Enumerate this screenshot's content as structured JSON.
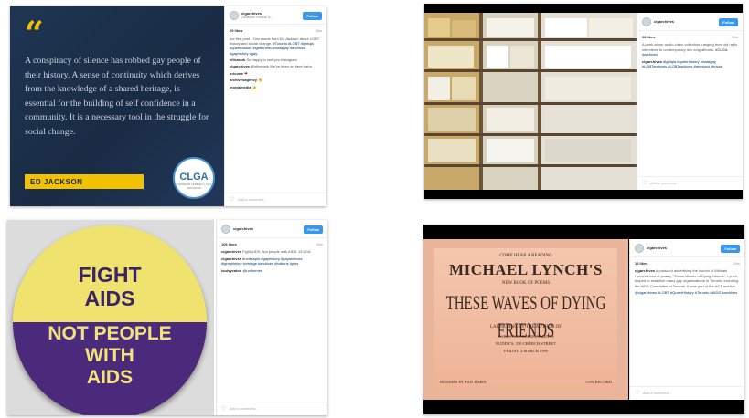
{
  "colors": {
    "follow_blue": "#3897f0",
    "quote_bg": "#1e3552",
    "quote_yellow": "#f2c200",
    "pin_yellow": "#efe26f",
    "pin_purple": "#4b2a7b",
    "poster_pink": "#f0bca1"
  },
  "post1": {
    "quote_mark": "“",
    "quote": "A conspiracy of silence has robbed gay people of their history. A sense of continuity which derives from the knowledge of a shared heritage, is essential for the building of self confidence in a community. It is a necessary tool in the struggle for social change.",
    "author": "ED JACKSON",
    "logo_text": "CLGA",
    "logo_sub": "CANADIAN LESBIAN + GAY ARCHIVES",
    "username": "clgarchives",
    "location": "Canadian Lesbian &...",
    "follow": "Follow",
    "likes": "29 likes",
    "time": "34w",
    "caption": "our first post - Two words from Ed Jackson about LGBT history and social change.",
    "tags": "#Toronto #LGBT #lgbtqia #queerhistory #lgbttoronto #instagay #archives #gayhistory #gay",
    "c1_user": "ellismark",
    "c1_text": "So happy to see you Instagram",
    "c2_user": "clgarchives",
    "c2_text": "@ellismark We've been on here haha",
    "c3_user": "bricowe",
    "c3_text": "❤",
    "c4_user": "archivesagency",
    "c4_text": "👏",
    "c5_user": "montamedia",
    "c5_text": "👍",
    "add_comment": "Add a comment..."
  },
  "post2": {
    "username": "clgarchives",
    "follow": "Follow",
    "likes": "28 likes",
    "time": "34w",
    "caption": "A peek at our audio-video collection, ranging from old radio interviews to contemporary doc long albums.",
    "tags": "#CLGA #archives",
    "c1_user": "clgarchives",
    "c1_text": "#lgbtqia #queerhistory #instagay #LGBTarchives #LGBTarchives #archived #bricks",
    "add_comment": "Add a comment..."
  },
  "post3": {
    "pin_line1": "FIGHT",
    "pin_line2": "AIDS",
    "pin_line3": "NOT PEOPLE",
    "pin_line4": "WITH",
    "pin_line5": "AIDS",
    "username": "clgarchives",
    "follow": "Follow",
    "likes": "106 likes",
    "time": "34w",
    "caption": "Fight AIDS, Not people with AIDS. #CLGA",
    "c1_user": "clgarchives",
    "c1_text": "#unlesspin #gayhistory #gayarchives #lgbtqhistory #vintage #archives #buttons #pins",
    "c2_user": "louisyeaton",
    "c2_text": "@uniformes",
    "add_comment": "Add a comment..."
  },
  "post4": {
    "poster_l1": "COME HEAR A READING",
    "poster_l2": "MICHAEL LYNCH'S",
    "poster_l3": "NEW BOOK OF POEMS",
    "poster_l4": "THESE WAVES OF DYING FRIENDS",
    "poster_l5": "LAUNCHING BY THE AUTHOR OF",
    "poster_l6": "CAKES AND REFRESHMENTS",
    "poster_l7": "BUDDY'S, 370 CHURCH STREET",
    "poster_l8": "FRIDAY, 3 MARCH 1989",
    "poster_l9": "BUDDIES IN BAD TIMES",
    "poster_l10": "GAY RECORD",
    "username": "clgarchives",
    "follow": "Follow",
    "likes": "15 likes",
    "time": "34w",
    "caption": "A postcard advertising the launch of Michael Lynch's book of poetry, \"These Waves of Dying Friends\". Lynch helped to establish many gay organizations in Toronto, including the AIDS Committee of Toronto. It was part of the ACT archive.",
    "tags": "@clgarchives #LGBT #QueerHistory #Toronto #AIDS #archives",
    "add_comment": "Add a comment..."
  }
}
